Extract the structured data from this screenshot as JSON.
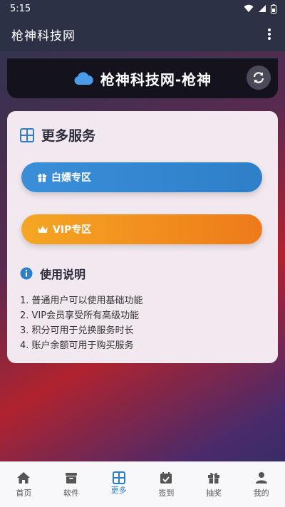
{
  "status": {
    "time": "5:15"
  },
  "app_bar": {
    "title": "枪神科技网"
  },
  "header": {
    "title": "枪神科技网-枪神"
  },
  "services": {
    "title": "更多服务",
    "buttons": [
      {
        "label": "白嫖专区"
      },
      {
        "label": "VIP专区"
      }
    ]
  },
  "usage": {
    "title": "使用说明",
    "items": [
      "1. 普通用户可以使用基础功能",
      "2. VIP会员享受所有高级功能",
      "3. 积分可用于兑换服务时长",
      "4. 账户余额可用于购买服务"
    ]
  },
  "nav": {
    "items": [
      {
        "label": "首页",
        "icon": "home-icon"
      },
      {
        "label": "软件",
        "icon": "box-icon"
      },
      {
        "label": "更多",
        "icon": "grid-icon",
        "active": true
      },
      {
        "label": "签到",
        "icon": "calendar-check-icon"
      },
      {
        "label": "抽奖",
        "icon": "gift-icon"
      },
      {
        "label": "我的",
        "icon": "user-icon"
      }
    ]
  },
  "colors": {
    "accent": "#2e7fc8",
    "vip": "#f0911d",
    "bar": "#2d3146"
  }
}
